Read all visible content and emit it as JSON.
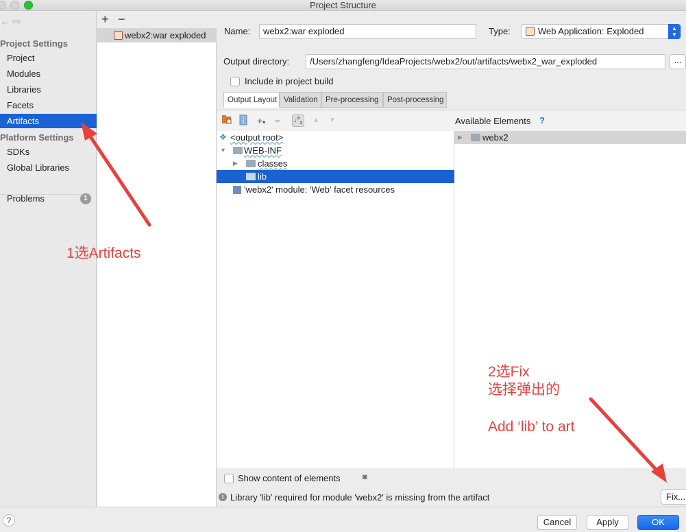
{
  "window": {
    "title": "Project Structure"
  },
  "nav": {
    "back_icon": "←",
    "forward_icon": "⇨",
    "project_settings_label": "Project Settings",
    "platform_settings_label": "Platform Settings",
    "items": [
      {
        "label": "Project"
      },
      {
        "label": "Modules"
      },
      {
        "label": "Libraries"
      },
      {
        "label": "Facets"
      },
      {
        "label": "Artifacts"
      },
      {
        "label": "SDKs"
      },
      {
        "label": "Global Libraries"
      },
      {
        "label": "Problems",
        "badge": "1"
      }
    ],
    "selected": "Artifacts"
  },
  "artifacts": {
    "add_icon": "+",
    "remove_icon": "−",
    "items": [
      {
        "label": "webx2:war exploded"
      }
    ]
  },
  "form": {
    "name_label": "Name:",
    "name_value": "webx2:war exploded",
    "type_label": "Type:",
    "type_value": "Web Application: Exploded",
    "output_dir_label": "Output directory:",
    "output_dir_value": "/Users/zhangfeng/IdeaProjects/webx2/out/artifacts/webx2_war_exploded",
    "browse_label": "...",
    "include_build_label": "Include in project build"
  },
  "tabs": [
    {
      "label": "Output Layout",
      "active": true
    },
    {
      "label": "Validation"
    },
    {
      "label": "Pre-processing"
    },
    {
      "label": "Post-processing"
    }
  ],
  "layout_tree": [
    {
      "label": "<output root>"
    },
    {
      "label": "WEB-INF"
    },
    {
      "label": "classes"
    },
    {
      "label": "lib"
    },
    {
      "label": "'webx2' module: 'Web' facet resources"
    }
  ],
  "available": {
    "header": "Available Elements",
    "help_icon": "?",
    "items": [
      {
        "label": "webx2"
      }
    ]
  },
  "bottom": {
    "show_content_label": "Show content of elements",
    "warning_text": "Library 'lib' required for module 'webx2' is missing from the artifact",
    "fix_label": "Fix..."
  },
  "footer": {
    "help_label": "?",
    "cancel_label": "Cancel",
    "apply_label": "Apply",
    "ok_label": "OK"
  },
  "annotations": {
    "step1": "1选Artifacts",
    "step2_line1": "2选Fix",
    "step2_line2": "选择弹出的",
    "step2_line3": "Add ‘lib’ to art"
  },
  "colors": {
    "selection": "#1a62d4",
    "annotation": "#e8413c",
    "primary_button": "#1468e8"
  }
}
